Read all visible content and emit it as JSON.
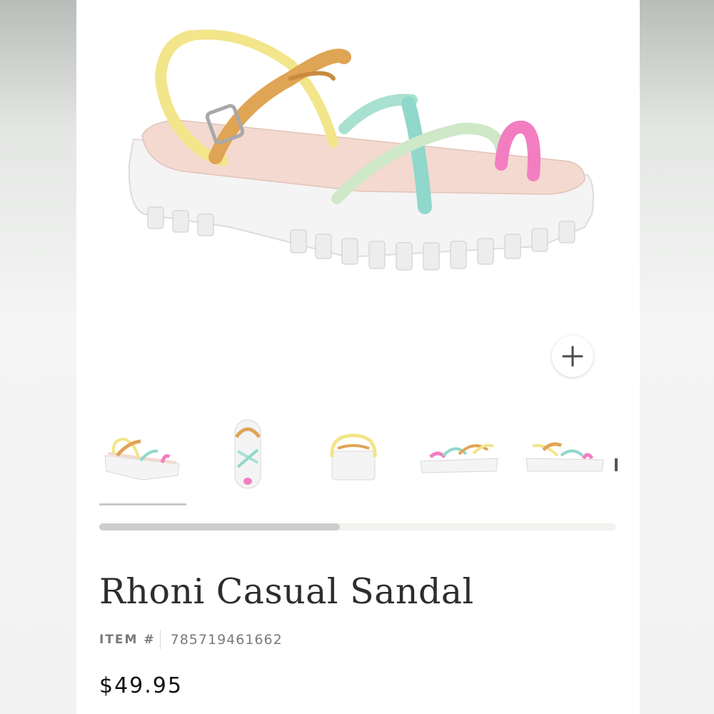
{
  "product": {
    "title": "Rhoni Casual Sandal",
    "item_label": "ITEM #",
    "item_number": "785719461662",
    "price": "$49.95"
  },
  "gallery": {
    "main_image": "sandal-main-image",
    "zoom_icon": "plus-icon",
    "thumbnails": [
      {
        "name": "thumb-side-view",
        "active": true
      },
      {
        "name": "thumb-top-view",
        "active": false
      },
      {
        "name": "thumb-back-view",
        "active": false
      },
      {
        "name": "thumb-inner-side-view",
        "active": false
      },
      {
        "name": "thumb-outer-side-view",
        "active": false
      }
    ],
    "scroll_position": 0.47
  },
  "colors": {
    "strap_yellow": "#f3e58a",
    "strap_tan": "#e0a455",
    "strap_mint": "#a9e1d0",
    "strap_teal": "#8fd8cb",
    "strap_green": "#cfe8c8",
    "strap_pink": "#f27ec1",
    "sole": "#f4f4f4",
    "footbed": "#f3d9cf"
  }
}
